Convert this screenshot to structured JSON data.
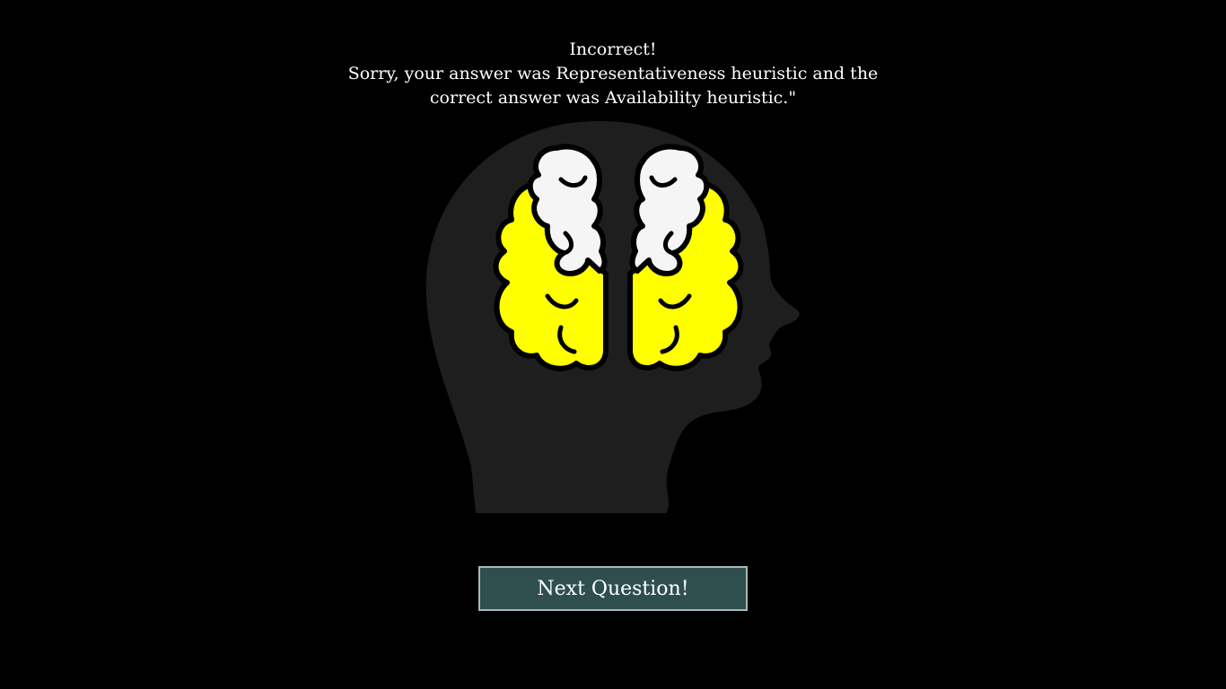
{
  "feedback": {
    "heading": "Incorrect!",
    "line1": "Sorry, your answer was Representativeness heuristic and the",
    "line2": "correct answer was Availability heuristic.\""
  },
  "illustration": {
    "icon": "head-brain-icon",
    "colors": {
      "head": "#1e1e1e",
      "brain_primary": "#ffff00",
      "brain_secondary": "#f5f5f5",
      "outline": "#000000"
    }
  },
  "actions": {
    "next_label": "Next Question!"
  },
  "colors": {
    "background": "#000000",
    "button_bg": "#2f4f4f",
    "button_border": "#a9b8b8",
    "text": "#ffffff"
  }
}
